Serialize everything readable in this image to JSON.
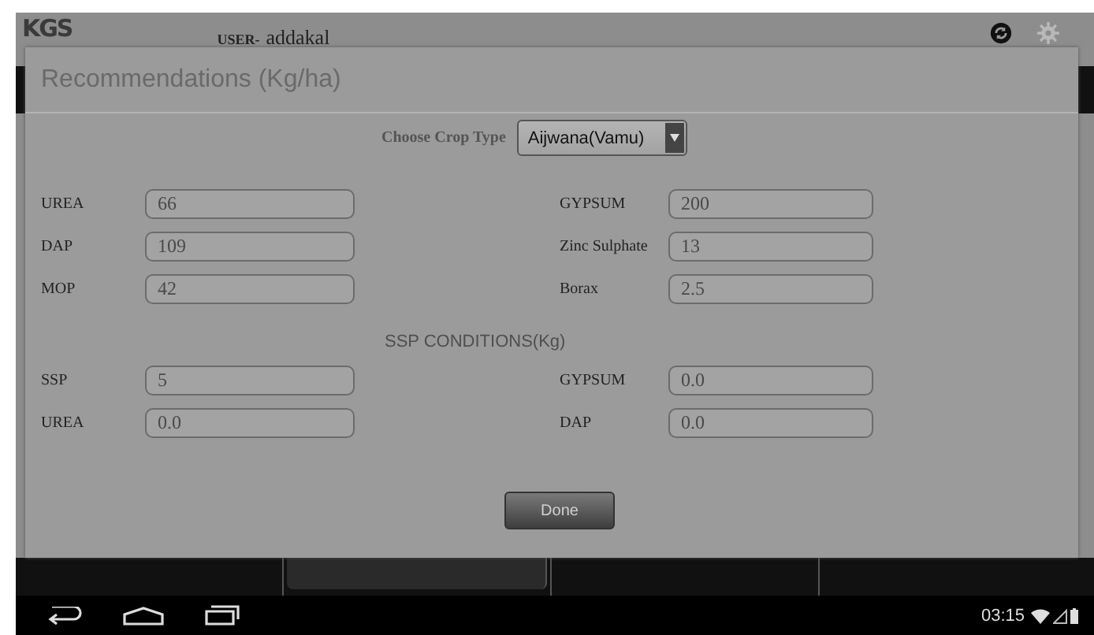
{
  "app_header": {
    "logo": "KGS",
    "user_label": "USER-",
    "user_name": "addakal"
  },
  "dialog": {
    "title": "Recommendations (Kg/ha)",
    "crop_type": {
      "label": "Choose Crop Type",
      "value": "Aijwana(Vamu)"
    },
    "fields": [
      {
        "label": "UREA",
        "value": "66"
      },
      {
        "label": "GYPSUM",
        "value": "200"
      },
      {
        "label": "DAP",
        "value": "109"
      },
      {
        "label": "Zinc Sulphate",
        "value": "13"
      },
      {
        "label": "MOP",
        "value": "42"
      },
      {
        "label": "Borax",
        "value": "2.5"
      }
    ],
    "ssp_heading": "SSP CONDITIONS(Kg)",
    "ssp_fields": [
      {
        "label": "SSP",
        "value": "5"
      },
      {
        "label": "GYPSUM",
        "value": "0.0"
      },
      {
        "label": "UREA",
        "value": "0.0"
      },
      {
        "label": "DAP",
        "value": "0.0"
      }
    ],
    "done_button": "Done"
  },
  "status_bar": {
    "time": "03:15"
  }
}
